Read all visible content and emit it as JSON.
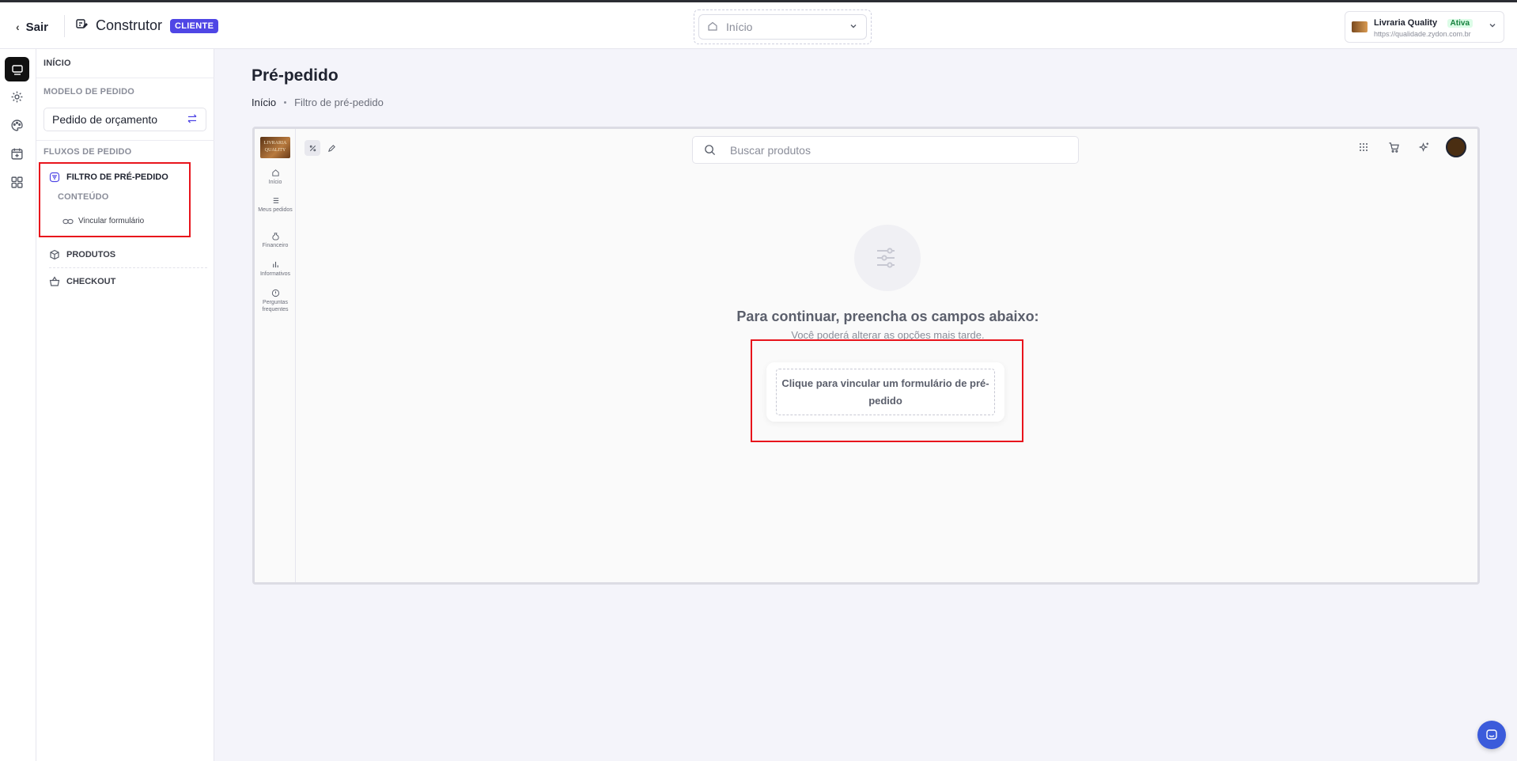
{
  "header": {
    "back_label": "Sair",
    "builder_title": "Construtor",
    "client_badge": "CLIENTE",
    "page_select_value": "Início",
    "store": {
      "name": "Livraria Quality",
      "status": "Ativa",
      "url": "https://qualidade.zydon.com.br"
    }
  },
  "sidebar": {
    "home_label": "INÍCIO",
    "model_section": "MODELO DE PEDIDO",
    "model_value": "Pedido de orçamento",
    "flows_section": "FLUXOS DE PEDIDO",
    "flows": [
      {
        "label": "FILTRO DE PRÉ-PEDIDO"
      },
      {
        "label": "PRODUTOS"
      },
      {
        "label": "CHECKOUT"
      }
    ],
    "content_label": "CONTEÚDO",
    "link_form_label": "Vincular formulário"
  },
  "main": {
    "title": "Pré-pedido",
    "breadcrumb": {
      "home": "Início",
      "current": "Filtro de pré-pedido"
    }
  },
  "preview": {
    "logo_text": "LIVRARIA QUALITY",
    "nav": [
      {
        "label": "Início"
      },
      {
        "label": "Meus pedidos"
      },
      {
        "label": "Financeiro"
      },
      {
        "label": "Informativos"
      },
      {
        "label": "Perguntas frequentes"
      }
    ],
    "search_placeholder": "Buscar produtos",
    "empty_title": "Para continuar, preencha os campos abaixo:",
    "empty_subtitle": "Você poderá alterar as opções mais tarde.",
    "link_card_text": "Clique para vincular um formulário de pré-pedido"
  },
  "colors": {
    "accent": "#4f46e5",
    "highlight": "#e8141c",
    "status_active": "#15803d",
    "chat": "#3b5bdb"
  }
}
